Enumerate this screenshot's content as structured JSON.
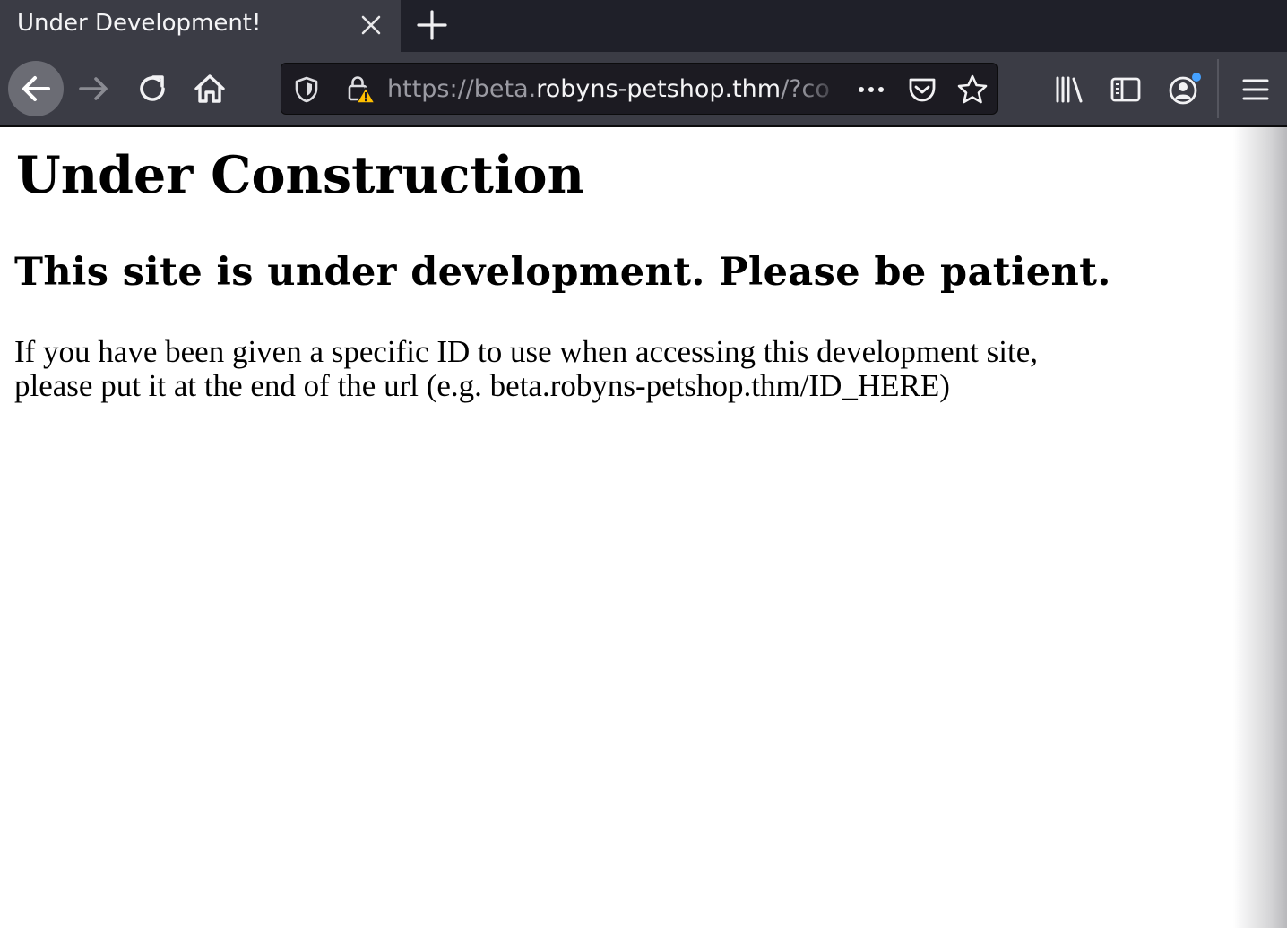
{
  "browser": {
    "tab": {
      "title": "Under Development!"
    },
    "url": {
      "scheme": "https://beta.",
      "host": "robyns-petshop.thm",
      "rest": "/?co"
    },
    "icons": {
      "back": "arrow-left-icon",
      "forward": "arrow-right-icon",
      "reload": "reload-icon",
      "home": "home-icon",
      "tracking_protection": "shield-icon",
      "insecure_lock": "lock-warning-icon",
      "page_actions": "ellipsis-icon",
      "pocket": "pocket-icon",
      "bookmark": "star-icon",
      "library": "library-icon",
      "sidebar": "sidebar-icon",
      "account": "account-icon",
      "menu": "hamburger-icon"
    },
    "colors": {
      "notification_dot": "#45a1ff",
      "warning": "#ffbf00"
    }
  },
  "page": {
    "heading": "Under Construction",
    "subheading": "This site is under development. Please be patient.",
    "body_line1": "If you have been given a specific ID to use when accessing this development site,",
    "body_line2": "please put it at the end of the url (e.g. beta.robyns-petshop.thm/ID_HERE)"
  }
}
